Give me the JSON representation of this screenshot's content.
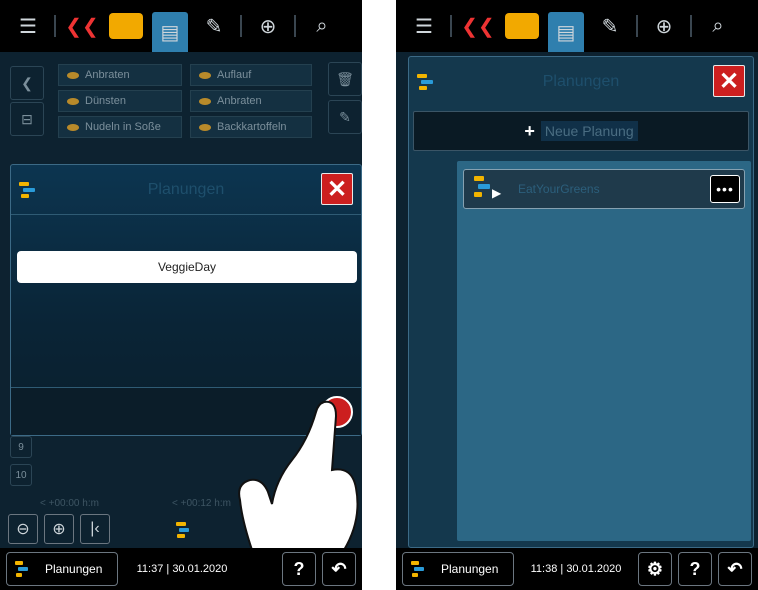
{
  "left": {
    "recipes": [
      {
        "label": "Anbraten"
      },
      {
        "label": "Auflauf"
      },
      {
        "label": "Dünsten"
      },
      {
        "label": "Anbraten"
      },
      {
        "label": "Nudeln in Soße"
      },
      {
        "label": "Backkartoffeln"
      }
    ],
    "dialog": {
      "title": "Planungen",
      "name_value": "VeggieDay"
    },
    "row_numbers": [
      "9",
      "10"
    ],
    "time_labels": [
      "< +00:00 h:m",
      "< +00:12 h:m"
    ],
    "footer": {
      "button_label": "Planungen",
      "time": "11:37",
      "date": "30.01.2020"
    }
  },
  "right": {
    "dialog": {
      "title": "Planungen",
      "new_plan_label": "Neue Planung",
      "plus": "+"
    },
    "plans": [
      {
        "name": "EatYourGreens"
      }
    ],
    "footer": {
      "button_label": "Planungen",
      "time": "11:38",
      "date": "30.01.2020"
    }
  },
  "colors": {
    "accent_red": "#cc1f1f",
    "active_tab": "#2f7fae",
    "plan_yellow": "#f2b400",
    "plan_blue": "#2a9bd8"
  },
  "icons": [
    "menu-icon",
    "fish-icon",
    "toque-icon",
    "planning-icon",
    "edit-icon",
    "add-icon",
    "search-icon",
    "close-icon",
    "help-icon",
    "back-icon",
    "settings-icon"
  ]
}
